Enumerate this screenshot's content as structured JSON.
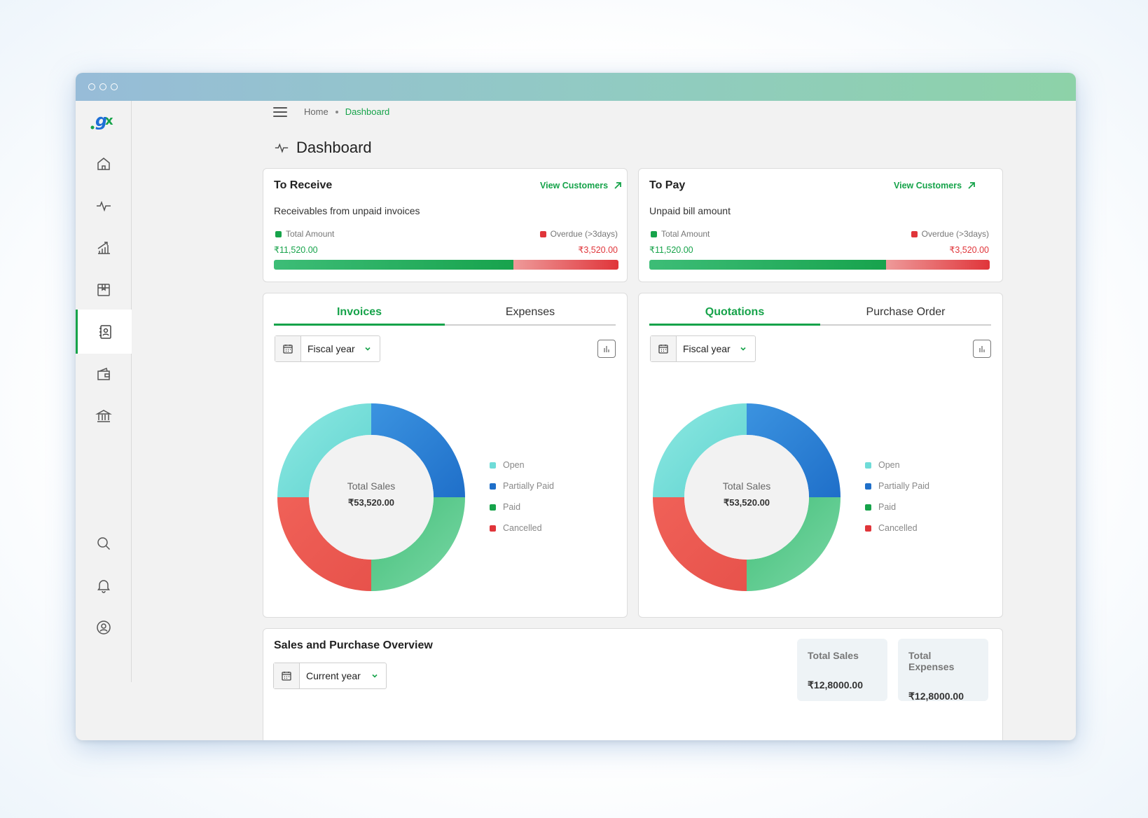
{
  "breadcrumb": {
    "home": "Home",
    "current": "Dashboard"
  },
  "page_title": "Dashboard",
  "colors": {
    "accent": "#16a34a",
    "danger": "#e0353a",
    "open": "#6fdcd8",
    "partially_paid": "#2f7fd6",
    "paid": "#3fbf7a",
    "cancelled": "#ee5a52"
  },
  "receive": {
    "title": "To Receive",
    "link": "View Customers",
    "subtitle": "Receivables from unpaid invoices",
    "total_label": "Total Amount",
    "overdue_label": "Overdue (>3days)",
    "total_value": "₹11,520.00",
    "overdue_value": "₹3,520.00",
    "paid_fraction": 0.695
  },
  "pay": {
    "title": "To Pay",
    "link": "View Customers",
    "subtitle": "Unpaid bill amount",
    "total_label": "Total Amount",
    "overdue_label": "Overdue (>3days)",
    "total_value": "₹11,520.00",
    "overdue_value": "₹3,520.00",
    "paid_fraction": 0.695
  },
  "sales_panel": {
    "tabs": [
      "Invoices",
      "Expenses"
    ],
    "active_tab": "Invoices",
    "filter": "Fiscal year",
    "center_label": "Total Sales",
    "center_value": "₹53,520.00",
    "legend": [
      "Open",
      "Partially Paid",
      "Paid",
      "Cancelled"
    ]
  },
  "purchase_panel": {
    "tabs": [
      "Quotations",
      "Purchase Order"
    ],
    "active_tab": "Quotations",
    "filter": "Fiscal year",
    "center_label": "Total Sales",
    "center_value": "₹53,520.00",
    "legend": [
      "Open",
      "Partially Paid",
      "Paid",
      "Cancelled"
    ]
  },
  "chart_data": [
    {
      "type": "pie",
      "categories": [
        "Open",
        "Partially Paid",
        "Paid",
        "Cancelled"
      ],
      "values": [
        25,
        25,
        25,
        25
      ]
    },
    {
      "type": "pie",
      "categories": [
        "Open",
        "Partially Paid",
        "Paid",
        "Cancelled"
      ],
      "values": [
        25,
        25,
        25,
        25
      ]
    }
  ],
  "overview": {
    "title": "Sales and Purchase Overview",
    "filter": "Current year",
    "total_sales_label": "Total Sales",
    "total_sales_value": "₹12,8000.00",
    "total_expenses_label": "Total Expenses",
    "total_expenses_value": "₹12,8000.00"
  },
  "sidebar": {
    "items": [
      "home-icon",
      "activity-icon",
      "chart-trend-icon",
      "inventory-box-icon",
      "contacts-icon",
      "wallet-icon",
      "bank-icon",
      "search-icon",
      "bell-icon",
      "user-icon"
    ],
    "active": "contacts-icon"
  }
}
